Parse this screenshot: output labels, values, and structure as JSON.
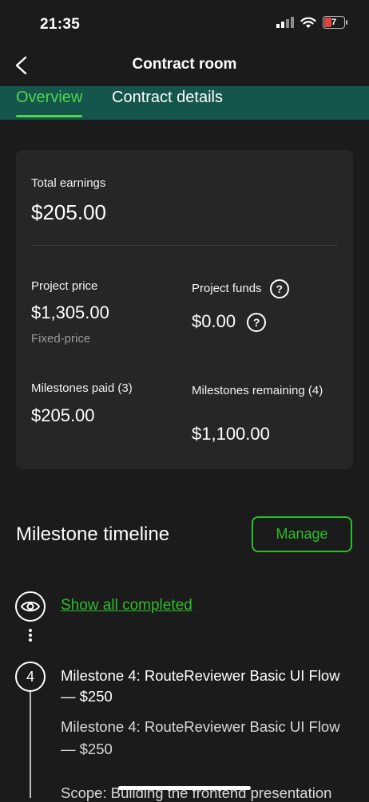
{
  "status_bar": {
    "time": "21:35",
    "battery_level": "7"
  },
  "nav": {
    "title": "Contract room"
  },
  "tabs": [
    {
      "label": "Overview",
      "active": true
    },
    {
      "label": "Contract details",
      "active": false
    }
  ],
  "earnings": {
    "total_label": "Total earnings",
    "total_value": "$205.00",
    "project_price_label": "Project price",
    "project_price_value": "$1,305.00",
    "project_price_type": "Fixed-price",
    "project_funds_label": "Project funds",
    "project_funds_value": "$0.00",
    "milestones_paid_label": "Milestones paid (3)",
    "milestones_paid_value": "$205.00",
    "milestones_remaining_label": "Milestones remaining (4)",
    "milestones_remaining_value": "$1,100.00"
  },
  "timeline": {
    "title": "Milestone timeline",
    "manage_label": "Manage",
    "show_all_label": "Show all completed",
    "milestone": {
      "number": "4",
      "title": "Milestone 4: RouteReviewer Basic UI Flow — $250",
      "description": "Milestone 4: RouteReviewer Basic UI Flow — $250",
      "scope_preview": "Scope: Building the frontend presentation"
    }
  },
  "colors": {
    "accent": "#2dbd2a",
    "tab_bar": "#14564c",
    "background": "#1b1b1b",
    "card": "#262626"
  }
}
